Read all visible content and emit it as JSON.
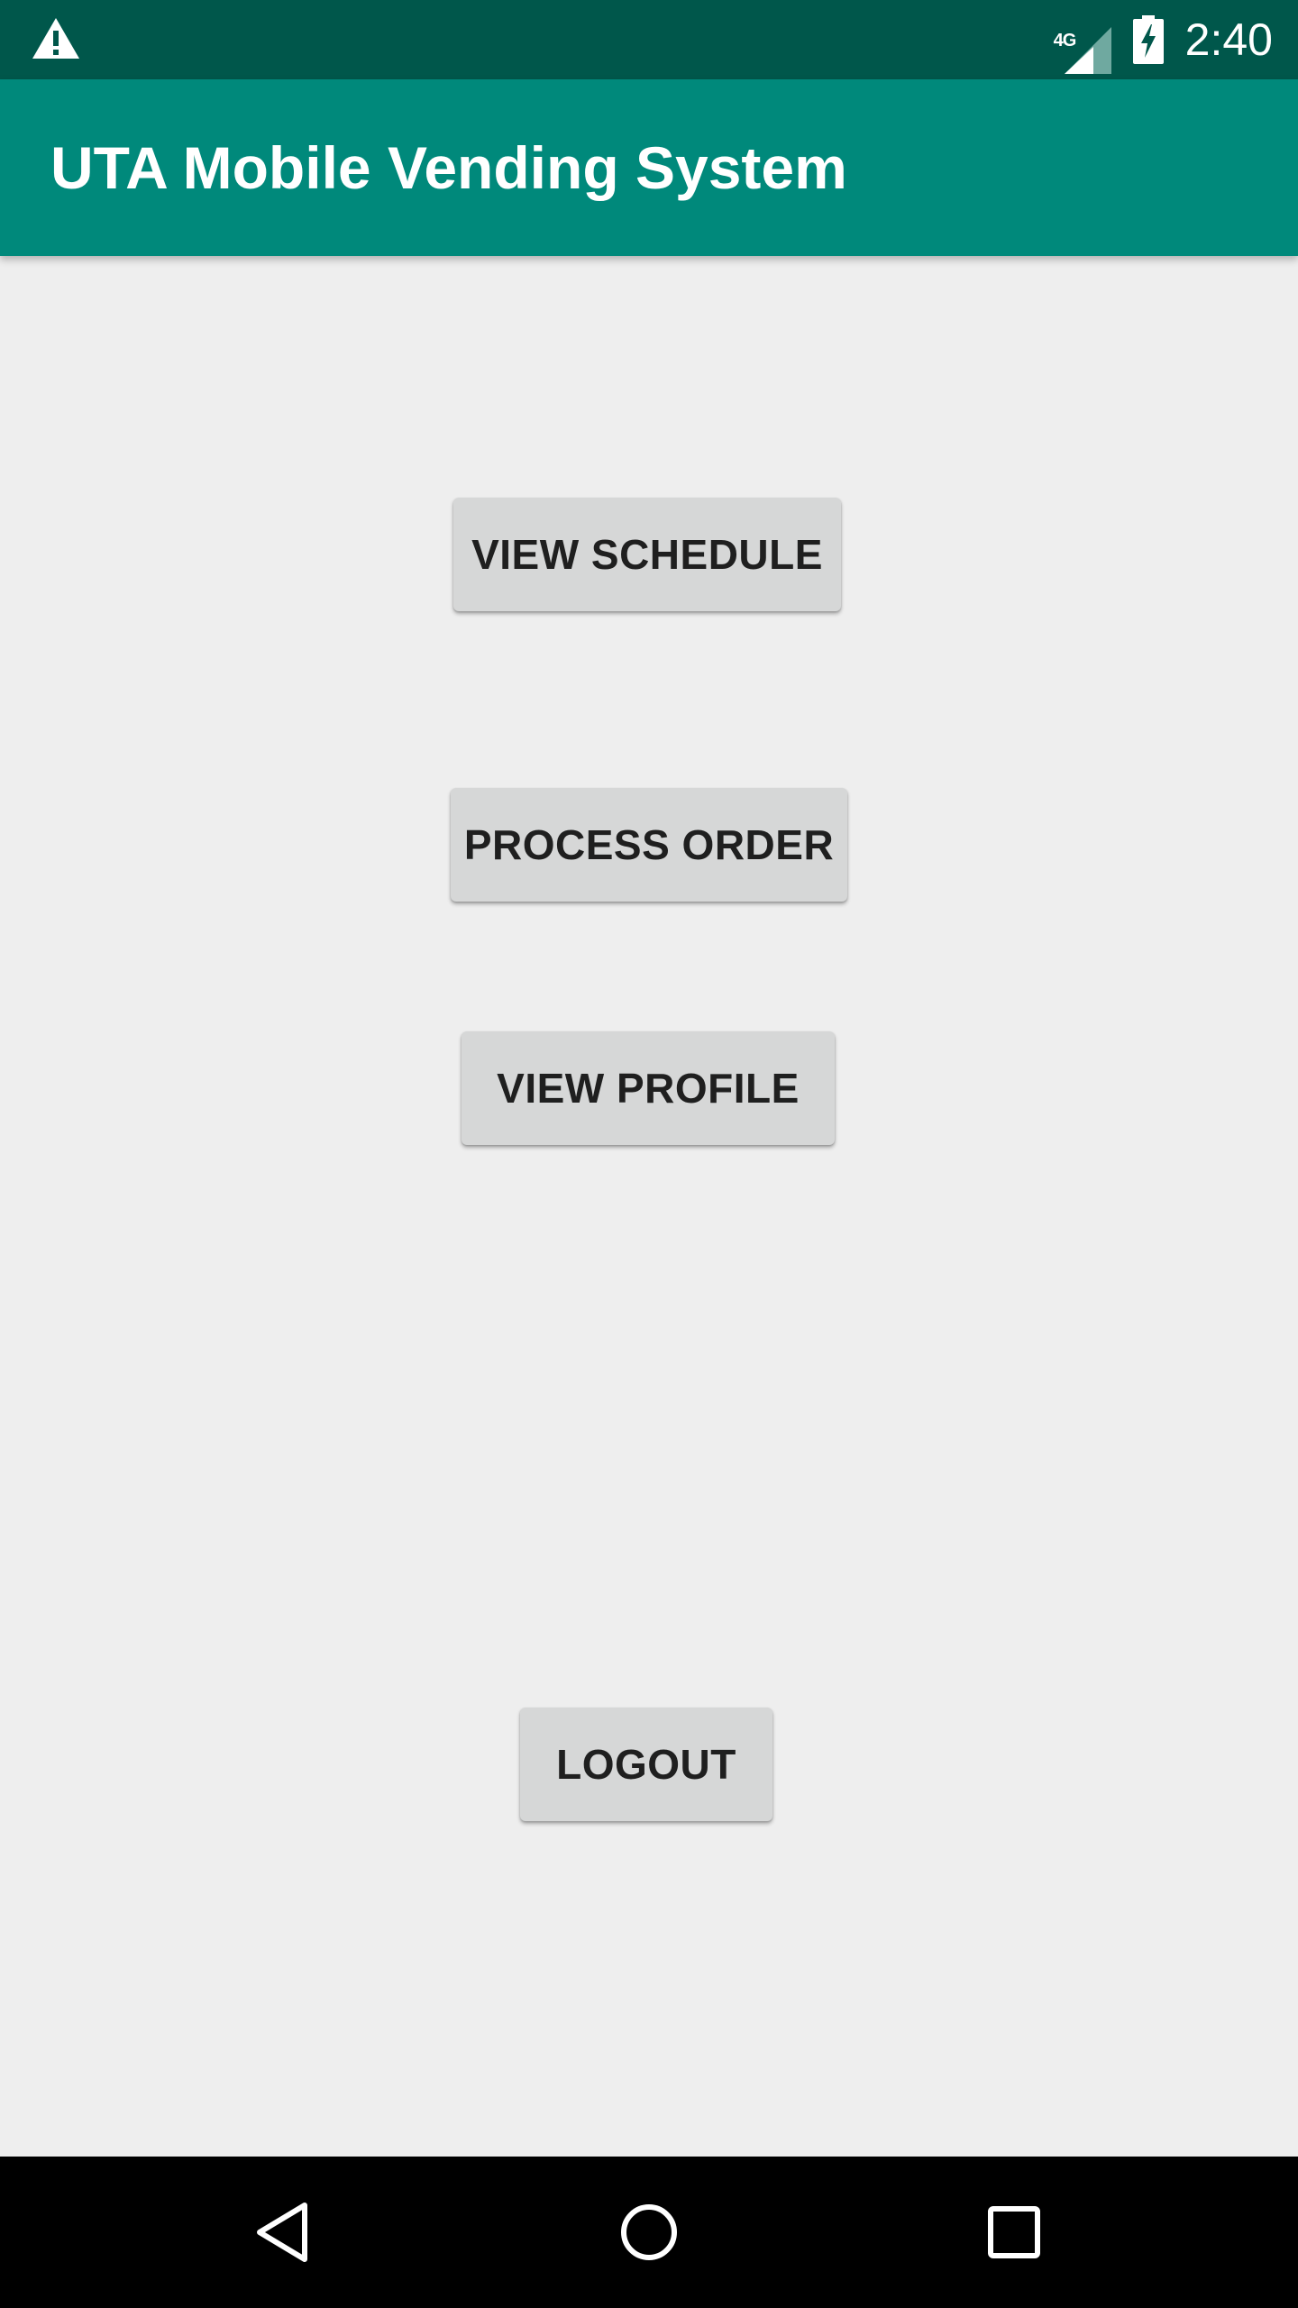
{
  "status_bar": {
    "network_label": "4G",
    "time": "2:40",
    "icons": [
      "warning-icon",
      "signal-icon",
      "battery-charging-icon"
    ]
  },
  "app_bar": {
    "title": "UTA Mobile Vending System"
  },
  "main": {
    "buttons": {
      "view_schedule": "VIEW SCHEDULE",
      "process_order": "PROCESS ORDER",
      "view_profile": "VIEW PROFILE",
      "logout": "LOGOUT"
    }
  },
  "nav_bar": {
    "icons": [
      "back-icon",
      "home-icon",
      "recents-icon"
    ]
  },
  "colors": {
    "status_bar": "#00574b",
    "app_bar": "#00897b",
    "background": "#eeeeee",
    "button": "#d6d7d7",
    "nav_bar": "#000000"
  }
}
